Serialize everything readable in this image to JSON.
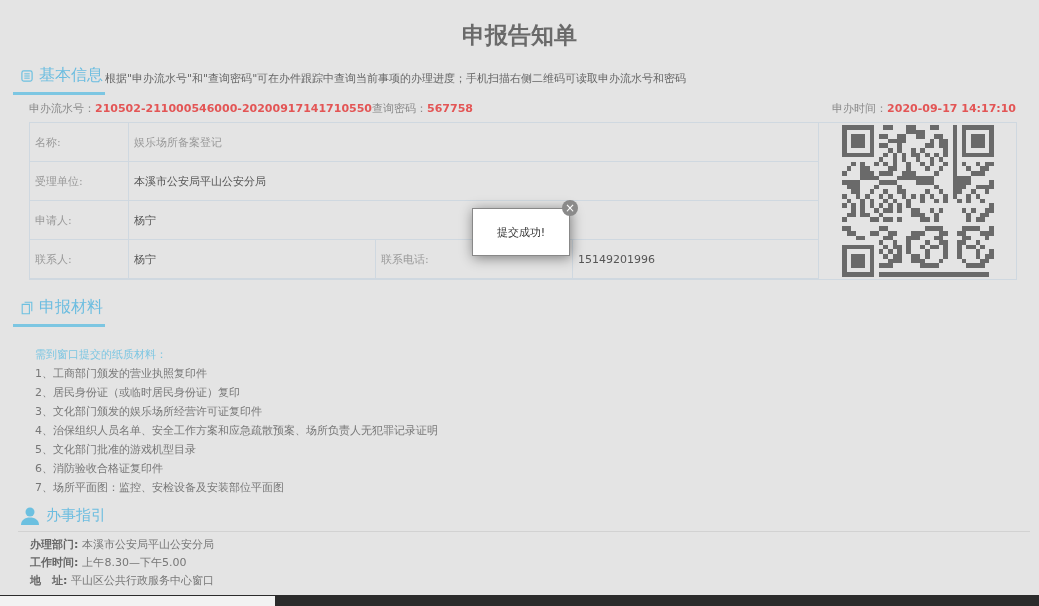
{
  "title": "申报告知单",
  "basic_info": {
    "heading": "基本信息",
    "hint": "根据\"申办流水号\"和\"查询密码\"可在办件跟踪中查询当前事项的办理进度；手机扫描右侧二维码可读取申办流水号和密码",
    "serial_label": "申办流水号：",
    "serial_value": "210502-211000546000-20200917141710550",
    "password_label": "查询密码：",
    "password_value": "567758",
    "time_label": "申办时间：",
    "time_value": "2020-09-17 14:17:10",
    "rows": [
      {
        "cells": [
          {
            "label": "名称:",
            "value": "娱乐场所备案登记"
          }
        ]
      },
      {
        "cells": [
          {
            "label": "受理单位:",
            "value": "本溪市公安局平山公安分局"
          }
        ]
      },
      {
        "cells": [
          {
            "label": "申请人:",
            "value": "杨宁"
          }
        ]
      },
      {
        "cells": [
          {
            "label": "联系人:",
            "value": "杨宁"
          },
          {
            "label": "联系电话:",
            "value": "15149201996"
          }
        ]
      }
    ]
  },
  "materials": {
    "heading": "申报材料",
    "intro": "需到窗口提交的纸质材料：",
    "items": [
      "1、工商部门颁发的营业执照复印件",
      "2、居民身份证（或临时居民身份证）复印",
      "3、文化部门颁发的娱乐场所经营许可证复印件",
      "4、治保组织人员名单、安全工作方案和应急疏散预案、场所负责人无犯罪记录证明",
      "5、文化部门批准的游戏机型目录",
      "6、消防验收合格证复印件",
      "7、场所平面图：监控、安检设备及安装部位平面图"
    ]
  },
  "guide": {
    "heading": "办事指引",
    "fields": [
      {
        "label": "办理部门:",
        "value": "本溪市公安局平山公安分局"
      },
      {
        "label": "工作时间:",
        "value": "上午8.30—下午5.00"
      },
      {
        "label": "地　址:",
        "value": "平山区公共行政服务中心窗口"
      }
    ]
  },
  "dialog": {
    "message": "提交成功!",
    "close": "×"
  }
}
